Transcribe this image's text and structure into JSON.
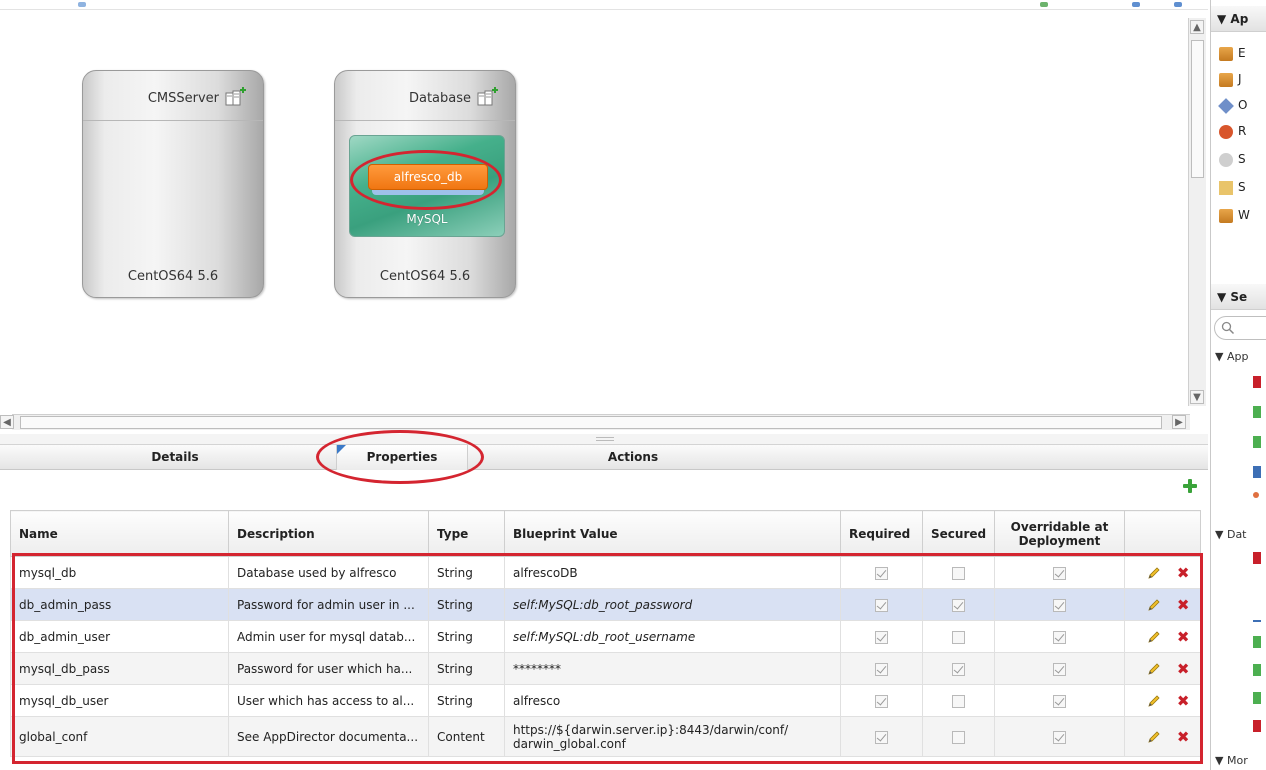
{
  "canvas": {
    "nodes": [
      {
        "title": "CMSServer",
        "os": "CentOS64 5.6"
      },
      {
        "title": "Database",
        "os": "CentOS64 5.6",
        "service": "MySQL",
        "component": "alfresco_db"
      }
    ]
  },
  "tabs": [
    {
      "label": "Details"
    },
    {
      "label": "Properties"
    },
    {
      "label": "Actions"
    }
  ],
  "table": {
    "headers": {
      "name": "Name",
      "description": "Description",
      "type": "Type",
      "blueprint": "Blueprint Value",
      "required": "Required",
      "secured": "Secured",
      "overridable": "Overridable at Deployment"
    },
    "rows": [
      {
        "name": "mysql_db",
        "description": "Database used by alfresco",
        "type": "String",
        "value": "alfrescoDB",
        "required": true,
        "secured": false,
        "overridable": true
      },
      {
        "name": "db_admin_pass",
        "description": "Password for admin user in ...",
        "type": "String",
        "value": "self:MySQL:db_root_password",
        "required": true,
        "secured": true,
        "overridable": true
      },
      {
        "name": "db_admin_user",
        "description": "Admin user for mysql datab...",
        "type": "String",
        "value": "self:MySQL:db_root_username",
        "required": true,
        "secured": false,
        "overridable": true
      },
      {
        "name": "mysql_db_pass",
        "description": "Password for user which ha...",
        "type": "String",
        "value": "********",
        "required": true,
        "secured": true,
        "overridable": true
      },
      {
        "name": "mysql_db_user",
        "description": "User which has access to al...",
        "type": "String",
        "value": "alfresco",
        "required": true,
        "secured": false,
        "overridable": true
      },
      {
        "name": "global_conf",
        "description": "See AppDirector documenta...",
        "type": "Content",
        "value": "https://${darwin.server.ip}:8443/darwin/conf/ darwin_global.conf",
        "required": true,
        "secured": false,
        "overridable": true
      }
    ]
  },
  "palette": {
    "section1": "Ap",
    "items": [
      "E",
      "J",
      "O",
      "R",
      "S",
      "S",
      "W"
    ],
    "section2": "Se",
    "sub1": "App",
    "sub2": "Dat",
    "sub3": "Mor"
  },
  "colors": {
    "accent_red": "#d42530",
    "component_orange": "#f07612",
    "service_green": "#3aa07e",
    "selected_row": "#d9e1f3"
  },
  "icons": {
    "node": "add-to-node-icon",
    "add": "green-plus-icon",
    "edit": "pencil-icon",
    "delete": "red-x-icon",
    "search": "search-icon"
  }
}
